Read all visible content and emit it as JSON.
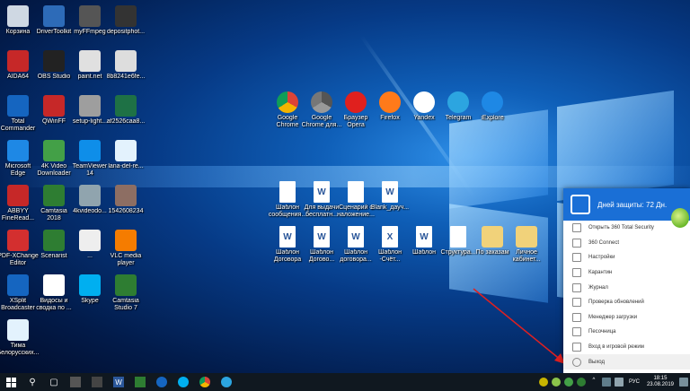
{
  "desktop_icons": [
    {
      "label": "Корзина",
      "icon": "recycle-bin-icon",
      "color": "#cfd8e3"
    },
    {
      "label": "DriverToolkit",
      "icon": "gear-icon",
      "color": "#2d6bb8"
    },
    {
      "label": "myFFmpeg",
      "icon": "film-icon",
      "color": "#555"
    },
    {
      "label": "depositphot...",
      "icon": "photo-icon",
      "color": "#333"
    },
    {
      "label": "AIDA64",
      "icon": "aida-icon",
      "color": "#c62828"
    },
    {
      "label": "OBS Studio",
      "icon": "obs-icon",
      "color": "#222"
    },
    {
      "label": "paint.net",
      "icon": "paint-icon",
      "color": "#e0e0e0"
    },
    {
      "label": "8b8241e6fe...",
      "icon": "file-icon",
      "color": "#ddd"
    },
    {
      "label": "Total\nCommander",
      "icon": "disk-icon",
      "color": "#1565c0"
    },
    {
      "label": "QWinFF",
      "icon": "qwinff-icon",
      "color": "#c62828"
    },
    {
      "label": "setup-light...",
      "icon": "setup-icon",
      "color": "#9e9e9e"
    },
    {
      "label": "af2526caa8...",
      "icon": "excel-icon",
      "color": "#1e7145"
    },
    {
      "label": "Microsoft\nEdge",
      "icon": "edge-icon",
      "color": "#1e88e5"
    },
    {
      "label": "4K Video\nDownloader",
      "icon": "download-icon",
      "color": "#43a047"
    },
    {
      "label": "TeamViewer\n14",
      "icon": "teamviewer-icon",
      "color": "#0e8ee9"
    },
    {
      "label": "lana-del-re...",
      "icon": "audio-icon",
      "color": "#e3f2fd"
    },
    {
      "label": "ABBYY\nFineRead...",
      "icon": "abbyy-icon",
      "color": "#c62828"
    },
    {
      "label": "Camtasia\n2018",
      "icon": "camtasia-icon",
      "color": "#2e7d32"
    },
    {
      "label": "4kvideodo...",
      "icon": "folder-icon",
      "color": "#90a4ae"
    },
    {
      "label": "1542608234",
      "icon": "image-icon",
      "color": "#8d6e63"
    },
    {
      "label": "PDF-XChange\nEditor",
      "icon": "pdf-icon",
      "color": "#d32f2f"
    },
    {
      "label": "Scenarist",
      "icon": "scenarist-icon",
      "color": "#2e7d32"
    },
    {
      "label": "...",
      "icon": "image-icon",
      "color": "#eee"
    },
    {
      "label": "VLC media\nplayer",
      "icon": "vlc-icon",
      "color": "#f57c00"
    },
    {
      "label": "XSplit\nBroadcaster",
      "icon": "xsplit-icon",
      "color": "#1565c0"
    },
    {
      "label": "Видосы и\nсводка по ...",
      "icon": "document-icon",
      "color": "#fff"
    },
    {
      "label": "Skype",
      "icon": "skype-icon",
      "color": "#00aff0"
    },
    {
      "label": "Camtasia\nStudio 7",
      "icon": "camtasia-icon",
      "color": "#2e7d32"
    },
    {
      "label": "Тима\nБелорусских...",
      "icon": "audio-icon",
      "color": "#e3f2fd"
    }
  ],
  "browser_icons": [
    {
      "label": "Google\nChrome",
      "icon": "chrome-icon"
    },
    {
      "label": "Google\nChrome для...",
      "icon": "chrome-dev-icon"
    },
    {
      "label": "Браузер\nOpera",
      "icon": "opera-icon"
    },
    {
      "label": "Firefox",
      "icon": "firefox-icon"
    },
    {
      "label": "Yandex",
      "icon": "yandex-icon"
    },
    {
      "label": "Telegram",
      "icon": "telegram-icon"
    },
    {
      "label": "iExplore",
      "icon": "ie-icon"
    }
  ],
  "doc_icons_row1": [
    {
      "label": "Шаблон\nсообщения...",
      "icon": "document-icon"
    },
    {
      "label": "Для выдачи\nбесплатн...",
      "icon": "word-icon"
    },
    {
      "label": "Сценарий с\nналожение...",
      "icon": "document-icon"
    },
    {
      "label": "Blank_дауч...",
      "icon": "word-icon"
    }
  ],
  "doc_icons_row2": [
    {
      "label": "Шаблон\nДоговора",
      "icon": "word-icon"
    },
    {
      "label": "Шаблон\nДогово...",
      "icon": "word-icon"
    },
    {
      "label": "Шаблон\nдоговора...",
      "icon": "word-icon"
    },
    {
      "label": "Шаблон\n-Счёт...",
      "icon": "excel-icon"
    },
    {
      "label": "Шаблон",
      "icon": "word-icon"
    },
    {
      "label": "Структура...",
      "icon": "document-icon"
    },
    {
      "label": "По заказам",
      "icon": "folder-icon"
    },
    {
      "label": "Личное\nкабинет...",
      "icon": "folder-icon"
    }
  ],
  "security_panel": {
    "header": "Дней защиты: 72 Дн.",
    "items": [
      {
        "label": "Открыть 360 Total Security"
      },
      {
        "label": "360 Connect"
      },
      {
        "label": "Настройки"
      },
      {
        "label": "Карантин"
      },
      {
        "label": "Журнал"
      },
      {
        "label": "Проверка обновлений"
      },
      {
        "label": "Менеджер загрузки"
      },
      {
        "label": "Песочница"
      },
      {
        "label": "Вход в игровой режим"
      },
      {
        "label": "Выход"
      }
    ]
  },
  "taskbar": {
    "language": "РУС",
    "time": "18:15",
    "date": "23.08.2019"
  },
  "colors": {
    "accent": "#1a6fd6",
    "arrow": "#e02020"
  }
}
